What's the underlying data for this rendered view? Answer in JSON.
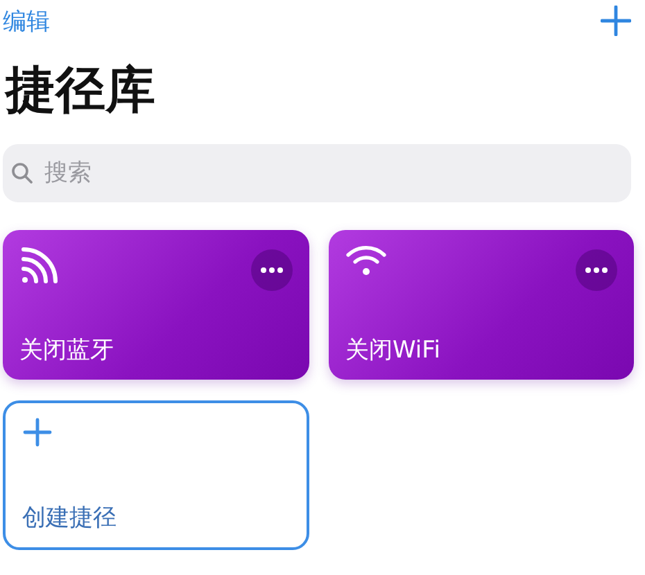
{
  "nav": {
    "edit": "编辑"
  },
  "title": "捷径库",
  "search": {
    "placeholder": "搜索"
  },
  "shortcuts": [
    {
      "kind": "waves",
      "name": "关闭蓝牙"
    },
    {
      "kind": "wifi",
      "name": "关闭WiFi"
    },
    {
      "kind": "create",
      "name": "创建捷径"
    }
  ]
}
